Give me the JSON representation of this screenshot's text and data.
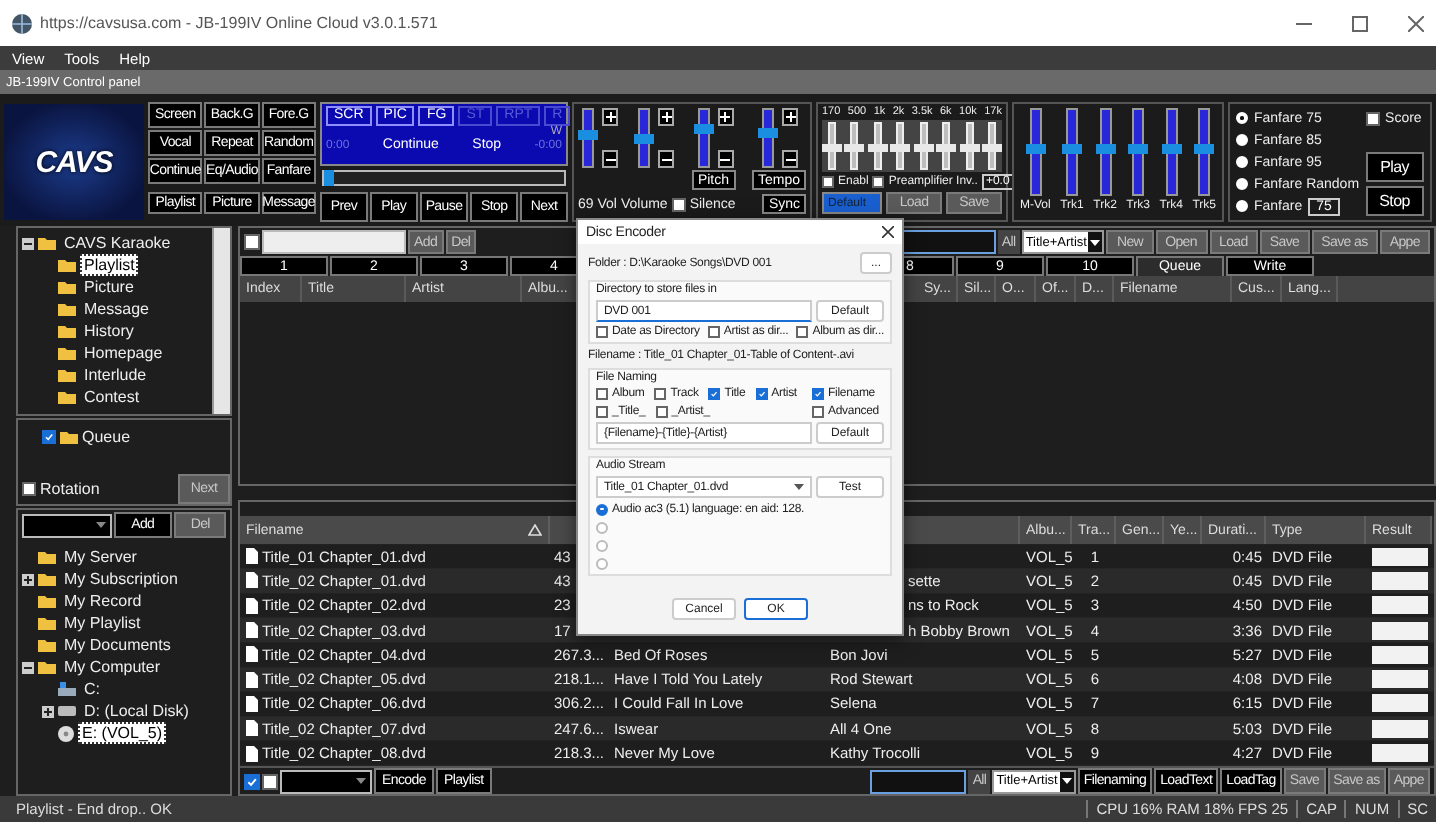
{
  "window": {
    "title": "https://cavsusa.com - JB-199IV Online Cloud v3.0.1.571"
  },
  "menu": [
    "View",
    "Tools",
    "Help"
  ],
  "panel_title": "JB-199IV Control panel",
  "logo": "CAVS",
  "control_buttons": [
    "Screen",
    "Back.G",
    "Fore.G",
    "Vocal",
    "Repeat",
    "Random",
    "Continue",
    "Eq/Audio",
    "Fanfare",
    "Playlist",
    "Picture",
    "Message"
  ],
  "display": {
    "flags": [
      {
        "label": "SCR",
        "on": true
      },
      {
        "label": "PIC",
        "on": true
      },
      {
        "label": "FG",
        "on": true
      },
      {
        "label": "ST",
        "on": false
      },
      {
        "label": "RPT",
        "on": false
      },
      {
        "label": "R",
        "on": false
      }
    ],
    "indicator": "W",
    "elapsed": "0:00",
    "mode": "Continue",
    "action": "Stop",
    "remaining": "-0:00",
    "level": 0
  },
  "transport": [
    "Prev",
    "Play",
    "Pause",
    "Stop",
    "Next"
  ],
  "audio_sliders": [
    {
      "level": 0.55
    },
    {
      "level": 0.5
    },
    {
      "level": 0.7,
      "caption": "Pitch"
    },
    {
      "level": 0.6,
      "caption": "Tempo"
    }
  ],
  "audio_footer": {
    "volume_value": "69 Vol",
    "volume_label": "Volume",
    "silence": {
      "label": "Silence",
      "checked": false
    },
    "sync": "Sync"
  },
  "eq": {
    "bands": [
      {
        "label": "170",
        "level": 0.5
      },
      {
        "label": "500",
        "level": 0.5
      },
      {
        "label": "1k",
        "level": 0.5
      },
      {
        "label": "2k",
        "level": 0.5
      },
      {
        "label": "3.5k",
        "level": 0.5
      },
      {
        "label": "6k",
        "level": 0.5
      },
      {
        "label": "10k",
        "level": 0.5
      },
      {
        "label": "17k",
        "level": 0.5
      }
    ],
    "enable": {
      "label": "Enabl",
      "checked": false
    },
    "preamp": {
      "label": "Preamplifier Inv..",
      "checked": false
    },
    "gain": "+0.0",
    "preset": "Default",
    "buttons": [
      "Load",
      "Save"
    ]
  },
  "mixer": [
    {
      "label": "M-Vol",
      "level": 0.55
    },
    {
      "label": "Trk1",
      "level": 0.55
    },
    {
      "label": "Trk2",
      "level": 0.55
    },
    {
      "label": "Trk3",
      "level": 0.55
    },
    {
      "label": "Trk4",
      "level": 0.55
    },
    {
      "label": "Trk5",
      "level": 0.55
    }
  ],
  "fanfare": {
    "options": [
      {
        "label": "Fanfare 75",
        "selected": true
      },
      {
        "label": "Fanfare 85",
        "selected": false
      },
      {
        "label": "Fanfare 95",
        "selected": false
      },
      {
        "label": "Fanfare Random",
        "selected": false
      },
      {
        "label": "Fanfare",
        "selected": false,
        "value": "75"
      }
    ],
    "score": {
      "label": "Score",
      "checked": false
    },
    "buttons": [
      "Play",
      "Stop"
    ]
  },
  "category_tree": [
    {
      "label": "CAVS Karaoke",
      "expanded": true,
      "selected": false,
      "children": [
        {
          "label": "Playlist",
          "selected": true
        },
        {
          "label": "Picture",
          "selected": false
        },
        {
          "label": "Message",
          "selected": false
        },
        {
          "label": "History",
          "selected": false
        },
        {
          "label": "Homepage",
          "selected": false
        },
        {
          "label": "Interlude",
          "selected": false
        },
        {
          "label": "Contest",
          "selected": false
        }
      ]
    }
  ],
  "queue": {
    "label": "Queue",
    "checked": true
  },
  "rotation": {
    "label": "Rotation",
    "checked": false
  },
  "next_button": "Next",
  "playlist_toolbar": {
    "checked": false,
    "add": "Add",
    "del": "Del",
    "filter": "All",
    "filter_mode": "Title+Artist",
    "buttons": [
      "New",
      "Open",
      "Load",
      "Save",
      "Save as",
      "Appe"
    ]
  },
  "playlist_tabs": [
    {
      "label": "1",
      "selected": false
    },
    {
      "label": "2",
      "selected": false
    },
    {
      "label": "3",
      "selected": false
    },
    {
      "label": "4",
      "selected": false
    },
    {
      "label": "8",
      "selected": false
    },
    {
      "label": "9",
      "selected": false
    },
    {
      "label": "10",
      "selected": false
    },
    {
      "label": "Queue",
      "selected": true
    },
    {
      "label": "Write",
      "selected": false
    }
  ],
  "playlist_columns": [
    "Index",
    "Title",
    "Artist",
    "Albu..."
  ],
  "playlist_columns_right": [
    "Sy...",
    "Sil...",
    "O...",
    "Of...",
    "D...",
    "Filename",
    "Cus...",
    "Lang..."
  ],
  "browser_toolbar": {
    "add": "Add",
    "del": "Del"
  },
  "file_tree": [
    {
      "label": "My Server",
      "kind": "folder",
      "selected": false
    },
    {
      "label": "My Subscription",
      "kind": "folder",
      "expanded": false,
      "selected": false
    },
    {
      "label": "My Record",
      "kind": "folder",
      "selected": false
    },
    {
      "label": "My Playlist",
      "kind": "folder",
      "selected": false
    },
    {
      "label": "My Documents",
      "kind": "folder",
      "selected": false
    },
    {
      "label": "My Computer",
      "kind": "folder",
      "expanded": true,
      "selected": false,
      "children": [
        {
          "label": "C:",
          "kind": "system-drive",
          "selected": false
        },
        {
          "label": "D: (Local Disk)",
          "kind": "drive",
          "expanded": false,
          "selected": false
        },
        {
          "label": "E: (VOL_5)",
          "kind": "disc",
          "selected": true
        }
      ]
    }
  ],
  "file_columns": [
    "Filename",
    "Albu...",
    "Tra...",
    "Gen...",
    "Ye...",
    "Durati...",
    "Type",
    "Result"
  ],
  "files": [
    {
      "filename": "Title_01 Chapter_01.dvd",
      "size": "43",
      "album": "VOL_5",
      "track": "1",
      "duration": "0:45",
      "type": "DVD File"
    },
    {
      "filename": "Title_02 Chapter_01.dvd",
      "size": "43",
      "artist": "sette",
      "album": "VOL_5",
      "track": "2",
      "duration": "0:45",
      "type": "DVD File"
    },
    {
      "filename": "Title_02 Chapter_02.dvd",
      "size": "23",
      "artist": "ns to Rock",
      "album": "VOL_5",
      "track": "3",
      "duration": "4:50",
      "type": "DVD File"
    },
    {
      "filename": "Title_02 Chapter_03.dvd",
      "size": "17",
      "artist": "h Bobby Brown",
      "album": "VOL_5",
      "track": "4",
      "duration": "3:36",
      "type": "DVD File"
    },
    {
      "filename": "Title_02 Chapter_04.dvd",
      "size": "267.3...",
      "title": "Bed Of Roses",
      "artist": "Bon Jovi",
      "album": "VOL_5",
      "track": "5",
      "duration": "5:27",
      "type": "DVD File"
    },
    {
      "filename": "Title_02 Chapter_05.dvd",
      "size": "218.1...",
      "title": "Have I Told You Lately",
      "artist": "Rod Stewart",
      "album": "VOL_5",
      "track": "6",
      "duration": "4:08",
      "type": "DVD File"
    },
    {
      "filename": "Title_02 Chapter_06.dvd",
      "size": "306.2...",
      "title": "I Could Fall In Love",
      "artist": "Selena",
      "album": "VOL_5",
      "track": "7",
      "duration": "6:15",
      "type": "DVD File"
    },
    {
      "filename": "Title_02 Chapter_07.dvd",
      "size": "247.6...",
      "title": "Iswear",
      "artist": "All 4 One",
      "album": "VOL_5",
      "track": "8",
      "duration": "5:03",
      "type": "DVD File"
    },
    {
      "filename": "Title_02 Chapter_08.dvd",
      "size": "218.3...",
      "title": "Never My Love",
      "artist": "Kathy Trocolli",
      "album": "VOL_5",
      "track": "9",
      "duration": "4:27",
      "type": "DVD File"
    }
  ],
  "file_toolbar": {
    "checks": [
      {
        "checked": true
      },
      {
        "checked": false
      }
    ],
    "buttons": [
      "Encode",
      "Playlist"
    ],
    "filter": "All",
    "filter_mode": "Title+Artist",
    "actions": [
      "Filenaming",
      "LoadText",
      "LoadTag",
      "Save",
      "Save as",
      "Appe"
    ]
  },
  "status_bar": {
    "message": "Playlist - End drop.. OK",
    "stats": "CPU 16% RAM 18% FPS 25",
    "indicators": [
      "CAP",
      "NUM",
      "SC"
    ]
  },
  "dialog": {
    "title": "Disc Encoder",
    "folder": "Folder : D:\\Karaoke Songs\\DVD 001",
    "browse": "...",
    "directory": {
      "legend": "Directory to store files in",
      "value": "DVD 001",
      "button": "Default",
      "options": [
        {
          "label": "Date as Directory",
          "checked": false
        },
        {
          "label": "Artist as dir...",
          "checked": false
        },
        {
          "label": "Album as dir...",
          "checked": false
        }
      ]
    },
    "filename": "Filename : Title_01 Chapter_01-Table of Content-.avi",
    "naming": {
      "legend": "File Naming",
      "options": [
        {
          "label": "Album",
          "checked": false
        },
        {
          "label": "Track",
          "checked": false
        },
        {
          "label": "Title",
          "checked": true
        },
        {
          "label": "Artist",
          "checked": true
        },
        {
          "label": "_Title_",
          "checked": false
        },
        {
          "label": "_Artist_",
          "checked": false
        }
      ],
      "side_options": [
        {
          "label": "Filename",
          "checked": true
        },
        {
          "label": "Advanced",
          "checked": false
        }
      ],
      "pattern": "{Filename}-{Title}-{Artist}",
      "button": "Default"
    },
    "audio": {
      "legend": "Audio Stream",
      "source": "Title_01 Chapter_01.dvd",
      "button": "Test",
      "streams": [
        {
          "label": "Audio  ac3 (5.1) language: en aid: 128.",
          "selected": true
        },
        {
          "selected": false
        },
        {
          "selected": false
        },
        {
          "selected": false
        }
      ]
    },
    "buttons": [
      "Cancel",
      "OK"
    ]
  }
}
